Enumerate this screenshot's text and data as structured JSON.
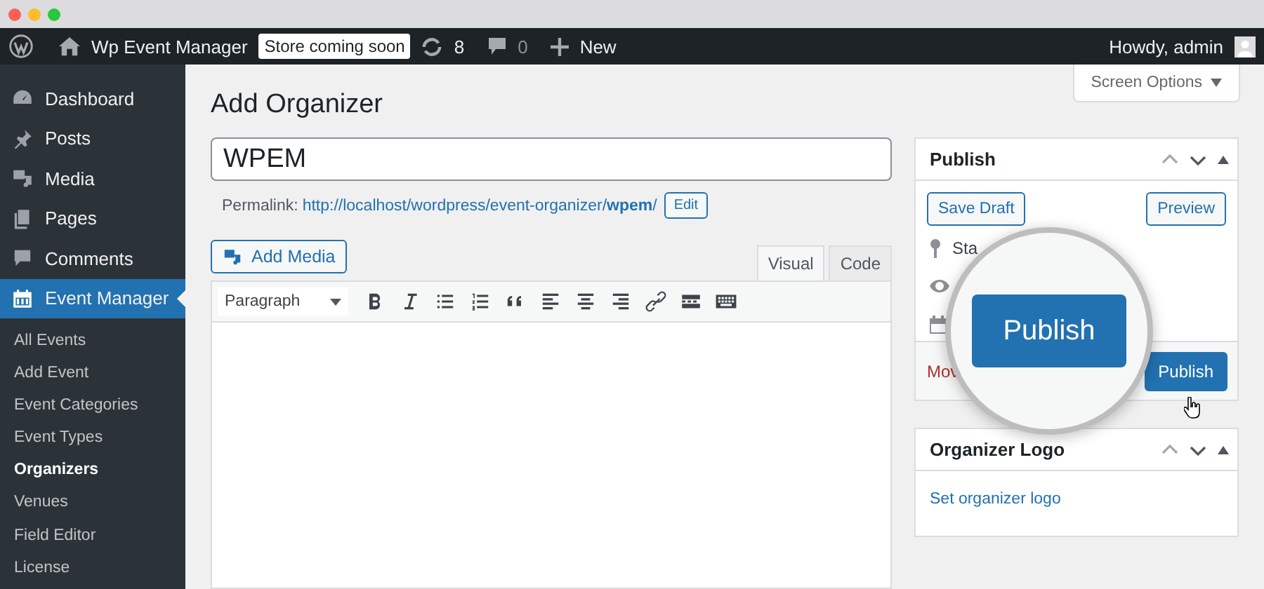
{
  "admin_bar": {
    "site_name": "Wp Event Manager",
    "store_badge": "Store coming soon",
    "updates_count": "8",
    "comments_count": "0",
    "new_label": "New",
    "greeting": "Howdy, admin"
  },
  "sidebar": {
    "items": [
      {
        "label": "Dashboard",
        "selected": false
      },
      {
        "label": "Posts",
        "selected": false
      },
      {
        "label": "Media",
        "selected": false
      },
      {
        "label": "Pages",
        "selected": false
      },
      {
        "label": "Comments",
        "selected": false
      },
      {
        "label": "Event Manager",
        "selected": true
      }
    ],
    "submenu": [
      {
        "label": "All Events",
        "selected": false
      },
      {
        "label": "Add Event",
        "selected": false
      },
      {
        "label": "Event Categories",
        "selected": false
      },
      {
        "label": "Event Types",
        "selected": false
      },
      {
        "label": "Organizers",
        "selected": true
      },
      {
        "label": "Venues",
        "selected": false
      },
      {
        "label": "Field Editor",
        "selected": false
      },
      {
        "label": "License",
        "selected": false
      }
    ]
  },
  "screen_options": "Screen Options",
  "page_title": "Add Organizer",
  "title_field": {
    "value": "WPEM"
  },
  "permalink": {
    "label": "Permalink:",
    "url_base": "http://localhost/wordpress/event-organizer/",
    "slug": "wpem",
    "slug_suffix": "/",
    "edit_button": "Edit"
  },
  "add_media": "Add Media",
  "editor_tabs": [
    {
      "label": "Visual",
      "selected": true
    },
    {
      "label": "Code",
      "selected": false
    }
  ],
  "format_select": "Paragraph",
  "publish_box": {
    "title": "Publish",
    "save_draft": "Save Draft",
    "preview": "Preview",
    "status_label": "Sta",
    "move_link": "Mov",
    "publish_button": "Publish",
    "magnified_button": "Publish"
  },
  "logo_box": {
    "title": "Organizer Logo",
    "link": "Set organizer logo"
  }
}
